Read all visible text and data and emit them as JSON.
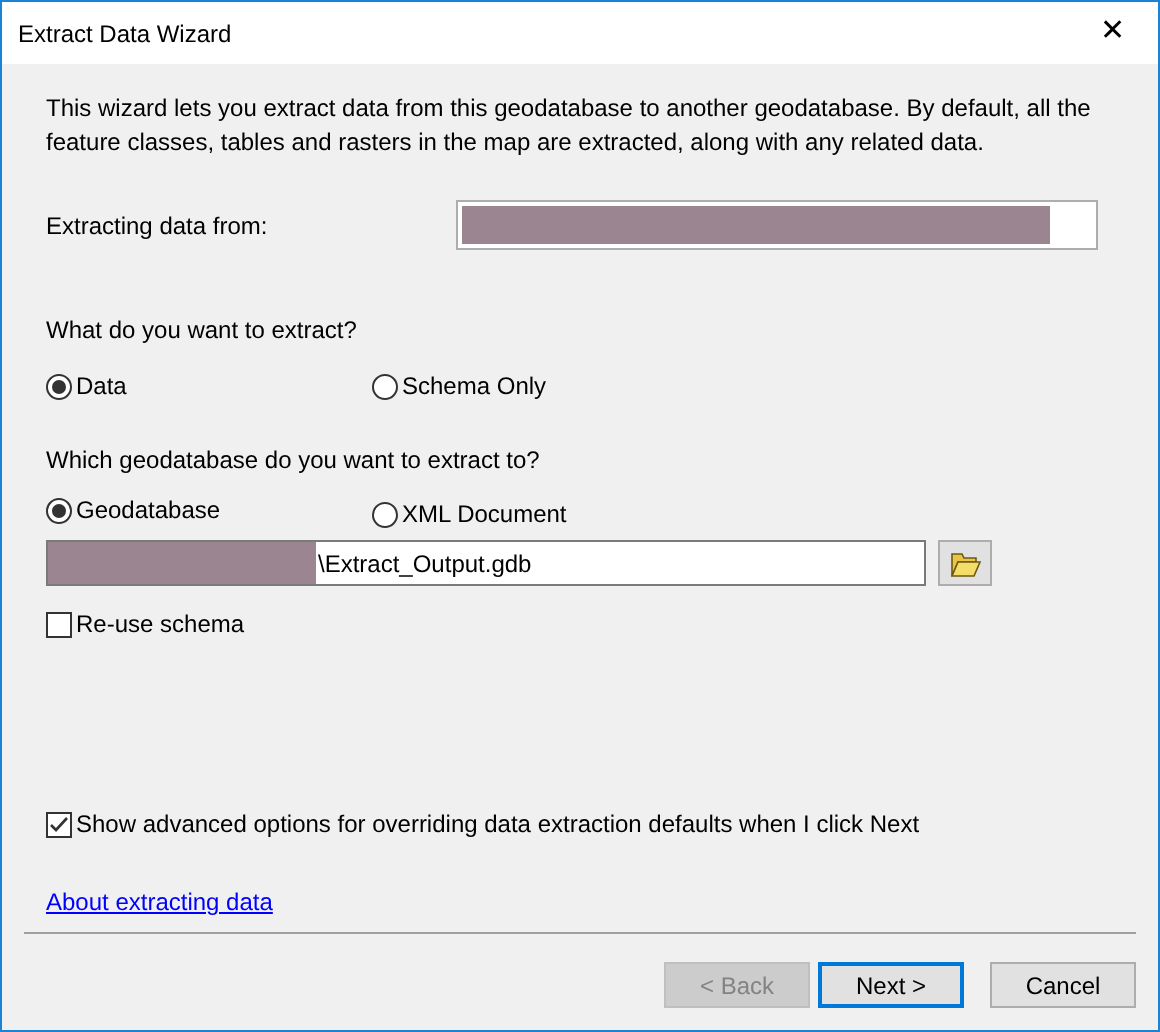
{
  "window": {
    "title": "Extract Data Wizard",
    "close": "✕"
  },
  "intro": "This wizard lets you extract data from this geodatabase to another geodatabase. By default, all the feature classes, tables and rasters in the map are extracted, along with any related data.",
  "source": {
    "label": "Extracting data from:"
  },
  "extract_what": {
    "question": "What do you want to extract?",
    "options": [
      {
        "label": "Data",
        "selected": true
      },
      {
        "label": "Schema Only",
        "selected": false
      }
    ]
  },
  "extract_to": {
    "question": "Which geodatabase do you want to extract to?",
    "options": [
      {
        "label": "Geodatabase",
        "selected": true
      },
      {
        "label": "XML Document",
        "selected": false
      }
    ]
  },
  "output_path": {
    "value": "\\Extract_Output.gdb"
  },
  "checkboxes": [
    {
      "label": "Re-use schema",
      "checked": false
    },
    {
      "label": "Show advanced options for overriding data extraction defaults when I click Next",
      "checked": true
    }
  ],
  "help_link": "About extracting data",
  "buttons": [
    {
      "label": "< Back",
      "disabled": true,
      "default": false
    },
    {
      "label": "Next >",
      "disabled": false,
      "default": true
    },
    {
      "label": "Cancel",
      "disabled": false,
      "default": false
    }
  ]
}
